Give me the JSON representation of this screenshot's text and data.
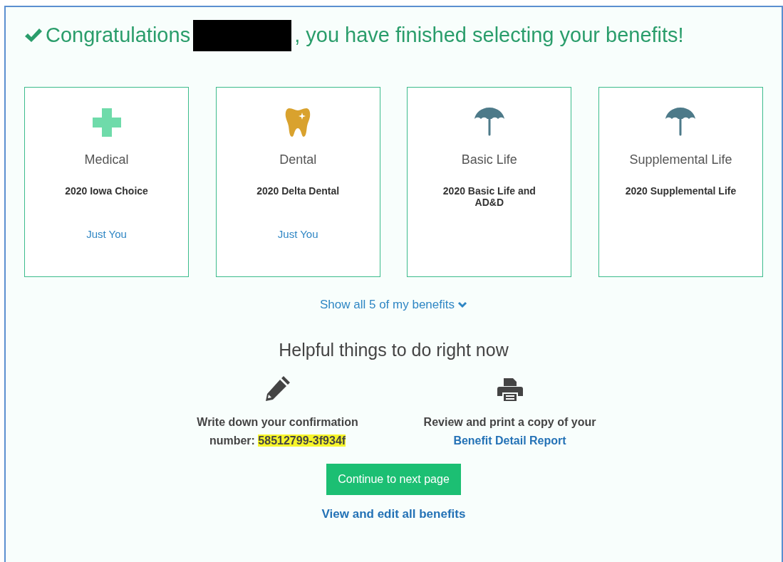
{
  "heading": {
    "before": "Congratulations",
    "redacted": true,
    "after": ", you have finished selecting your benefits!"
  },
  "benefits": [
    {
      "kind": "cross",
      "category": "Medical",
      "plan": "2020 Iowa Choice",
      "coverage": "Just You"
    },
    {
      "kind": "tooth",
      "category": "Dental",
      "plan": "2020 Delta Dental",
      "coverage": "Just You"
    },
    {
      "kind": "umbrella",
      "category": "Basic Life",
      "plan": "2020 Basic Life and AD&D"
    },
    {
      "kind": "umbrella",
      "category": "Supplemental Life",
      "plan": "2020 Supplemental Life"
    }
  ],
  "show_all": {
    "label": "Show all 5 of my benefits",
    "expanded": false
  },
  "helpful": {
    "title": "Helpful things to do right now",
    "items": [
      {
        "kind": "pencil",
        "text": "Write down your confirmation number:",
        "highlight": "58512799-3f934f"
      },
      {
        "kind": "printer",
        "text": "Review and print a copy of your",
        "link": "Benefit Detail Report"
      }
    ]
  },
  "continue_button": "Continue to next page",
  "edit_link": "View and edit all benefits"
}
